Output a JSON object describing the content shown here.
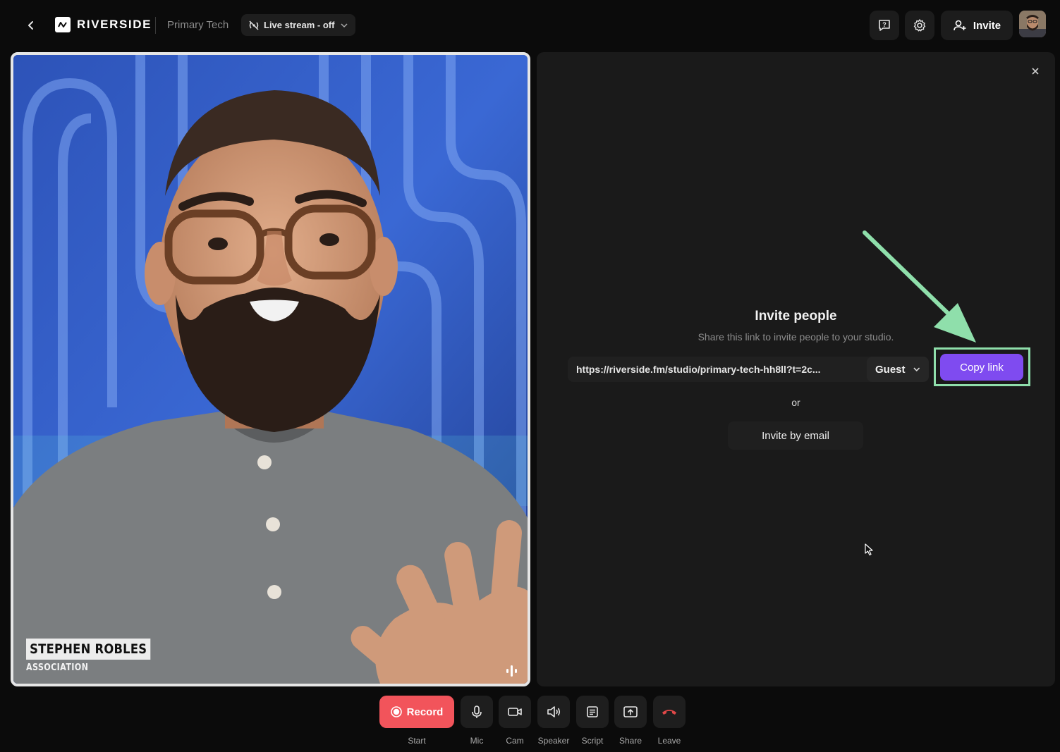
{
  "header": {
    "brand": "RIVERSIDE",
    "studio_name": "Primary Tech",
    "live_stream": "Live stream - off",
    "invite_label": "Invite"
  },
  "video": {
    "participant_name": "STEPHEN ROBLES",
    "participant_org": "ASSOCIATION"
  },
  "invite_panel": {
    "title": "Invite people",
    "subtitle": "Share this link to invite people to your studio.",
    "link": "https://riverside.fm/studio/primary-tech-hh8ll?t=2c...",
    "role": "Guest",
    "copy_label": "Copy link",
    "or_label": "or",
    "email_label": "Invite by email"
  },
  "toolbar": {
    "record_label": "Record",
    "start_label": "Start",
    "mic_label": "Mic",
    "cam_label": "Cam",
    "speaker_label": "Speaker",
    "script_label": "Script",
    "share_label": "Share",
    "leave_label": "Leave"
  },
  "colors": {
    "accent": "#7f4bf0",
    "record": "#f2545b",
    "highlight": "#8fdfab",
    "leave": "#e04848"
  },
  "icons": [
    "back-icon",
    "riverside-logo-icon",
    "live-off-icon",
    "chevron-down-icon",
    "feedback-icon",
    "gear-icon",
    "add-user-icon",
    "close-icon",
    "arrow-annotation",
    "mouse-cursor-icon",
    "record-dot-icon",
    "mic-icon",
    "camera-icon",
    "speaker-icon",
    "script-icon",
    "share-screen-icon",
    "leave-phone-icon"
  ]
}
